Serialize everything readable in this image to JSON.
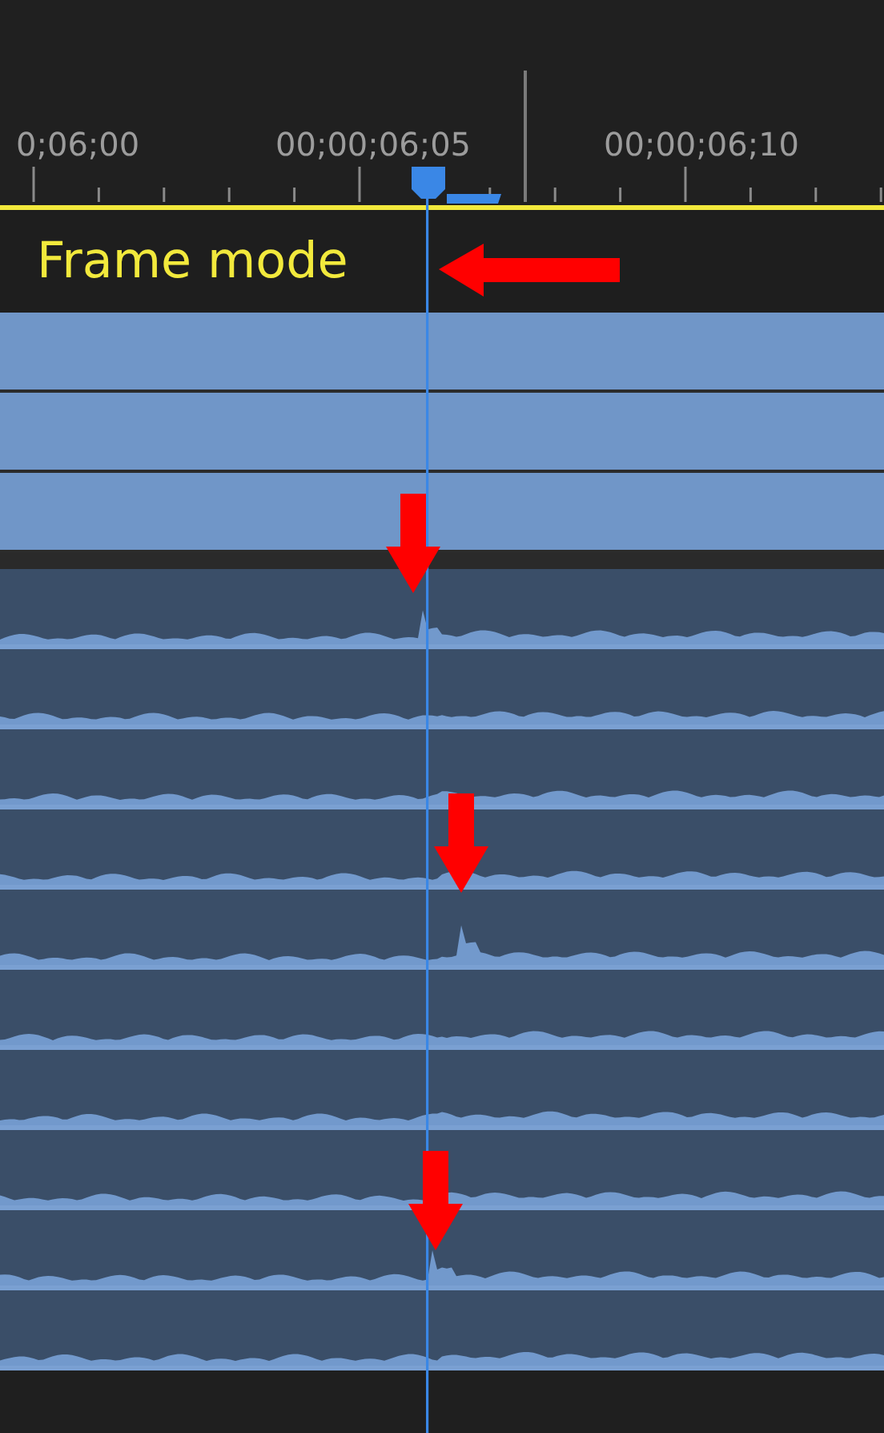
{
  "ruler": {
    "labels": [
      "0;06;00",
      "00;00;06;05",
      "00;00;06;10"
    ]
  },
  "banner": {
    "text": "Frame mode"
  },
  "tracks": [
    {
      "kind": "video"
    },
    {
      "kind": "video"
    },
    {
      "kind": "video"
    },
    {
      "kind": "gap"
    },
    {
      "kind": "audio"
    },
    {
      "kind": "audio"
    },
    {
      "kind": "audio"
    },
    {
      "kind": "audio"
    },
    {
      "kind": "audio"
    },
    {
      "kind": "audio"
    },
    {
      "kind": "audio"
    },
    {
      "kind": "audio"
    },
    {
      "kind": "audio"
    },
    {
      "kind": "audio"
    }
  ],
  "callouts": [
    {
      "kind": "left"
    },
    {
      "kind": "down"
    },
    {
      "kind": "down"
    },
    {
      "kind": "down"
    }
  ]
}
